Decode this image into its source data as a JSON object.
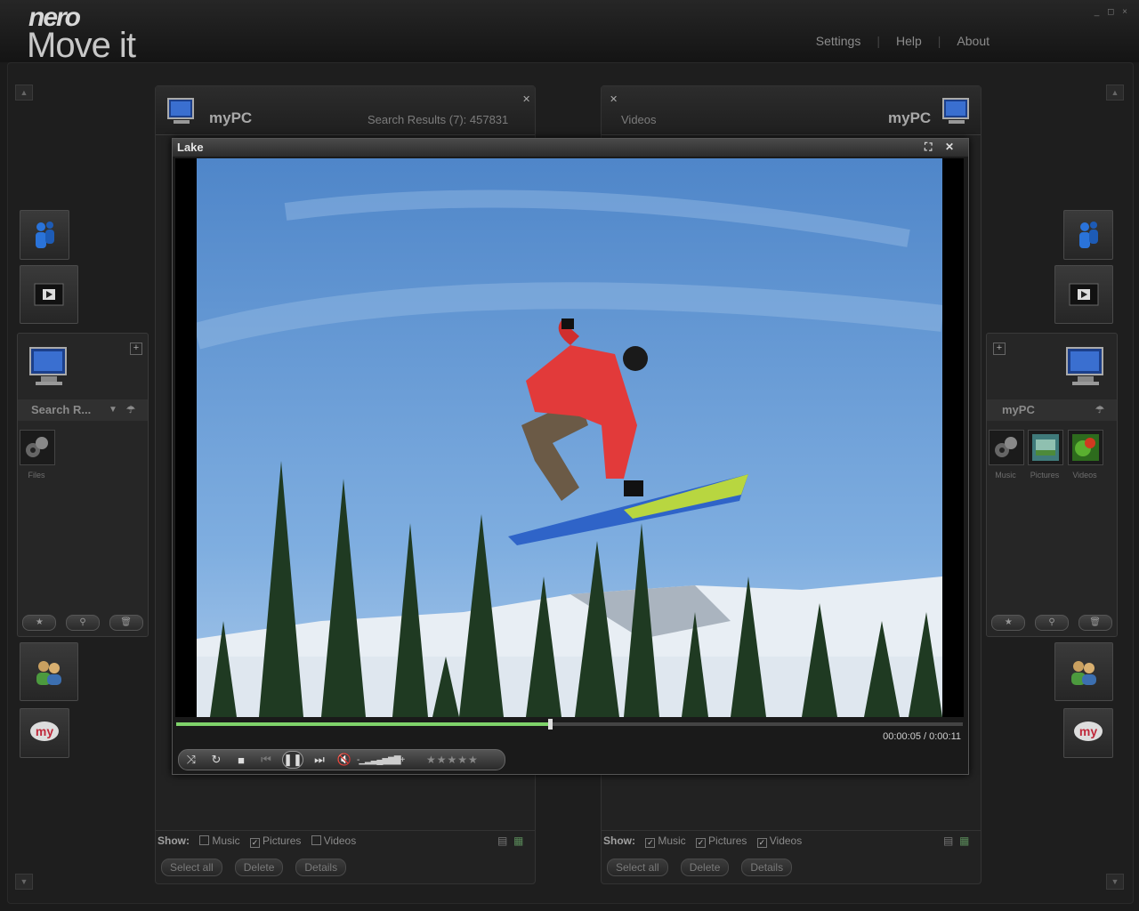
{
  "app": {
    "logo_top": "nero",
    "logo_bottom": "Move it",
    "nav": [
      "Settings",
      "Help",
      "About"
    ],
    "window_controls": "_ ◻ ×"
  },
  "left_sidepanel": {
    "title": "Search R...",
    "items": [
      {
        "label": "Files",
        "icon": "files-icon"
      }
    ]
  },
  "right_sidepanel": {
    "title": "myPC",
    "items": [
      {
        "label": "Music",
        "icon": "music-icon"
      },
      {
        "label": "Pictures",
        "icon": "pictures-icon"
      },
      {
        "label": "Videos",
        "icon": "videos-icon"
      }
    ]
  },
  "left_panel": {
    "name": "myPC",
    "subtitle": "Search Results (7): 457831",
    "show_label": "Show:",
    "filters": [
      {
        "label": "Music",
        "checked": false
      },
      {
        "label": "Pictures",
        "checked": true
      },
      {
        "label": "Videos",
        "checked": false
      }
    ],
    "actions": [
      "Select all",
      "Delete",
      "Details"
    ]
  },
  "right_panel": {
    "name": "myPC",
    "subtitle": "Videos",
    "show_label": "Show:",
    "filters": [
      {
        "label": "Music",
        "checked": true
      },
      {
        "label": "Pictures",
        "checked": true
      },
      {
        "label": "Videos",
        "checked": true
      }
    ],
    "actions": [
      "Select all",
      "Delete",
      "Details"
    ]
  },
  "player": {
    "title": "Lake",
    "timecode": "00:00:05 / 0:00:11",
    "progress": 0.475,
    "rating_stars": "★★★★★"
  }
}
